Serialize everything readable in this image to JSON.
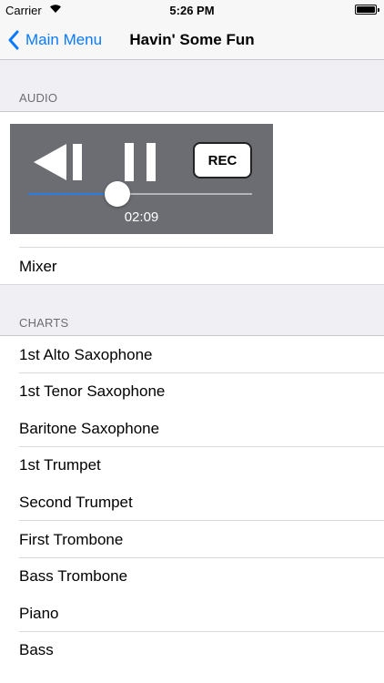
{
  "status_bar": {
    "carrier": "Carrier",
    "time": "5:26 PM"
  },
  "nav": {
    "back_label": "Main Menu",
    "title": "Havin' Some Fun"
  },
  "audio": {
    "section_header": "AUDIO",
    "rec_label": "REC",
    "playback_time": "02:09",
    "progress_fraction": 0.4,
    "mixer_label": "Mixer"
  },
  "charts": {
    "section_header": "CHARTS",
    "items": [
      "1st Alto Saxophone",
      "1st Tenor Saxophone",
      "Baritone Saxophone",
      "1st Trumpet",
      "Second Trumpet",
      "First Trombone",
      "Bass Trombone",
      "Piano",
      "Bass"
    ]
  },
  "colors": {
    "accent": "#0a7aff",
    "player_bg": "#6b6d72",
    "progress": "#2b7de0"
  }
}
